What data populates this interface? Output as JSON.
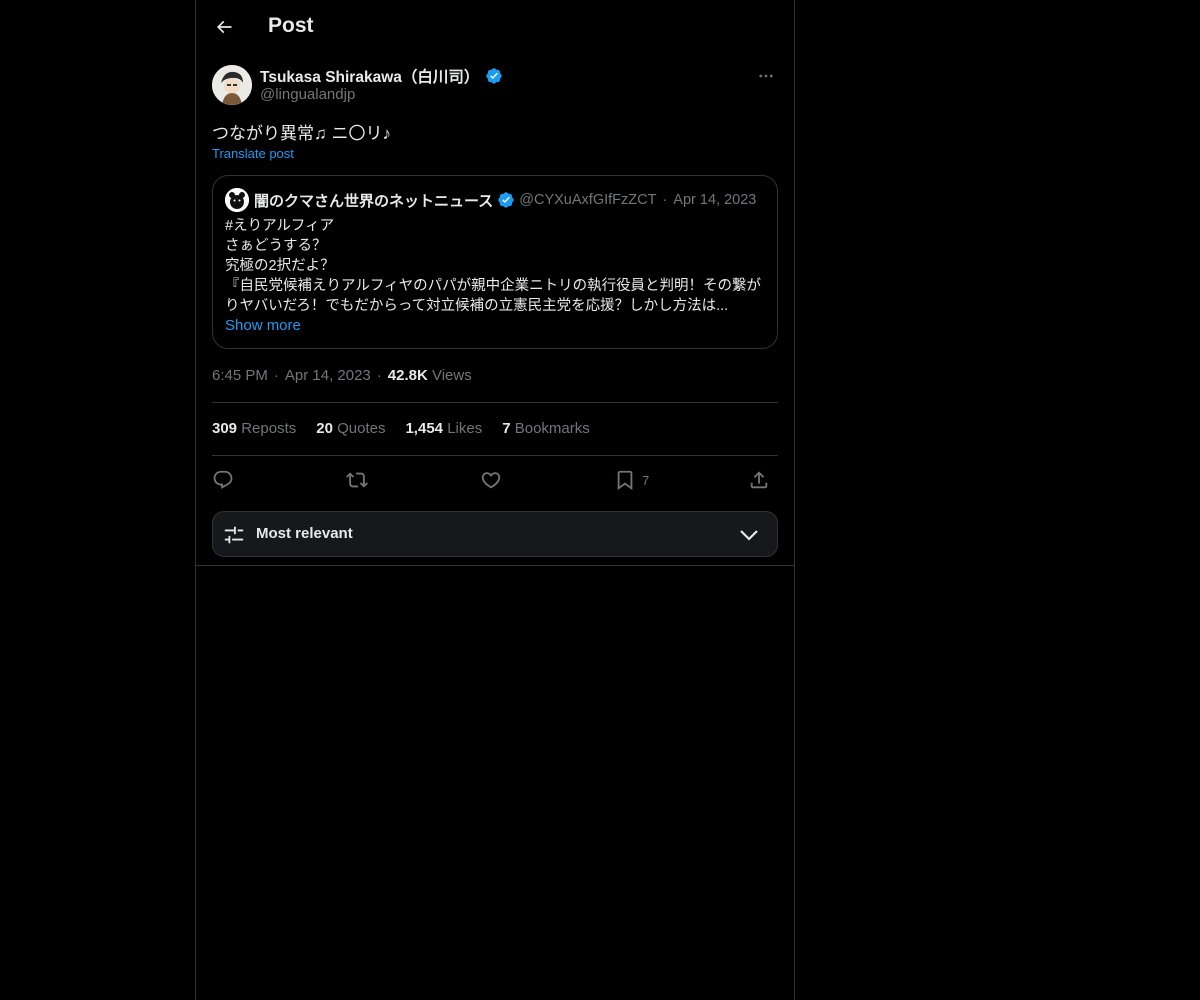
{
  "header": {
    "title": "Post"
  },
  "author": {
    "name": "Tsukasa Shirakawa（白川司）",
    "handle": "@lingualandjp"
  },
  "post": {
    "text": "つながり異常♫ ニ〇リ♪",
    "translate": "Translate post"
  },
  "quote": {
    "name": "闇のクマさん世界のネットニュース",
    "handle": "@CYXuAxfGIfFzZCT",
    "date": "Apr 14, 2023",
    "lines": [
      "#えりアルフィア",
      "さぁどうする？",
      "究極の2択だよ？",
      "『自民党候補えりアルフィヤのパパが親中企業ニトリの執行役員と判明！その繋がりヤバいだろ！でもだからって対立候補の立憲民主党を応援？しかし方法は..."
    ],
    "show_more": "Show more"
  },
  "meta": {
    "time": "6:45 PM",
    "date": "Apr 14, 2023",
    "views_count": "42.8K",
    "views_label": "Views"
  },
  "stats": {
    "reposts_count": "309",
    "reposts_label": "Reposts",
    "quotes_count": "20",
    "quotes_label": "Quotes",
    "likes_count": "1,454",
    "likes_label": "Likes",
    "bookmarks_count": "7",
    "bookmarks_label": "Bookmarks"
  },
  "actions": {
    "bookmark_count": "7",
    "icons": [
      "reply-icon",
      "repost-icon",
      "like-icon",
      "bookmark-icon",
      "share-icon"
    ]
  },
  "sort": {
    "label": "Most relevant"
  },
  "colors": {
    "accent": "#1d9bf0",
    "background": "#000000",
    "muted": "#71767b",
    "border": "#2f3336"
  }
}
